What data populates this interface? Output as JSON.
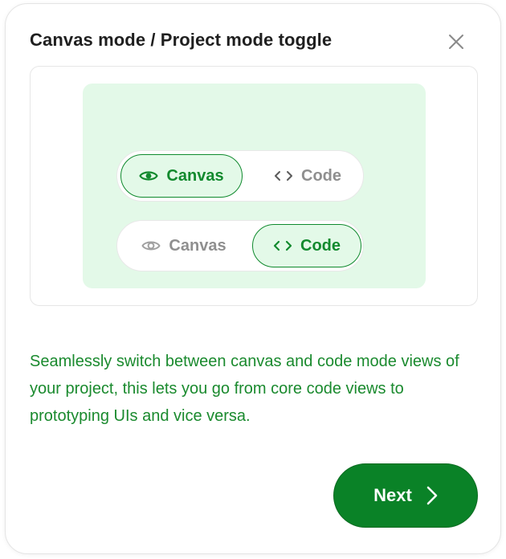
{
  "dialog": {
    "title": "Canvas mode / Project mode toggle",
    "close_icon": "close-icon",
    "description": "Seamlessly switch between canvas and code mode views of your project, this lets you go from core code views to prototyping UIs and vice versa.",
    "next_label": "Next",
    "next_icon": "chevron-right-icon"
  },
  "preview": {
    "toggle_canvas_active": {
      "canvas_label": "Canvas",
      "code_label": "Code",
      "active": "canvas"
    },
    "toggle_code_active": {
      "canvas_label": "Canvas",
      "code_label": "Code",
      "active": "code"
    }
  },
  "colors": {
    "accent": "#0a8227",
    "accent_text": "#128a2e",
    "preview_background": "#e3f9e8",
    "inactive_text": "#8f8f8f"
  }
}
